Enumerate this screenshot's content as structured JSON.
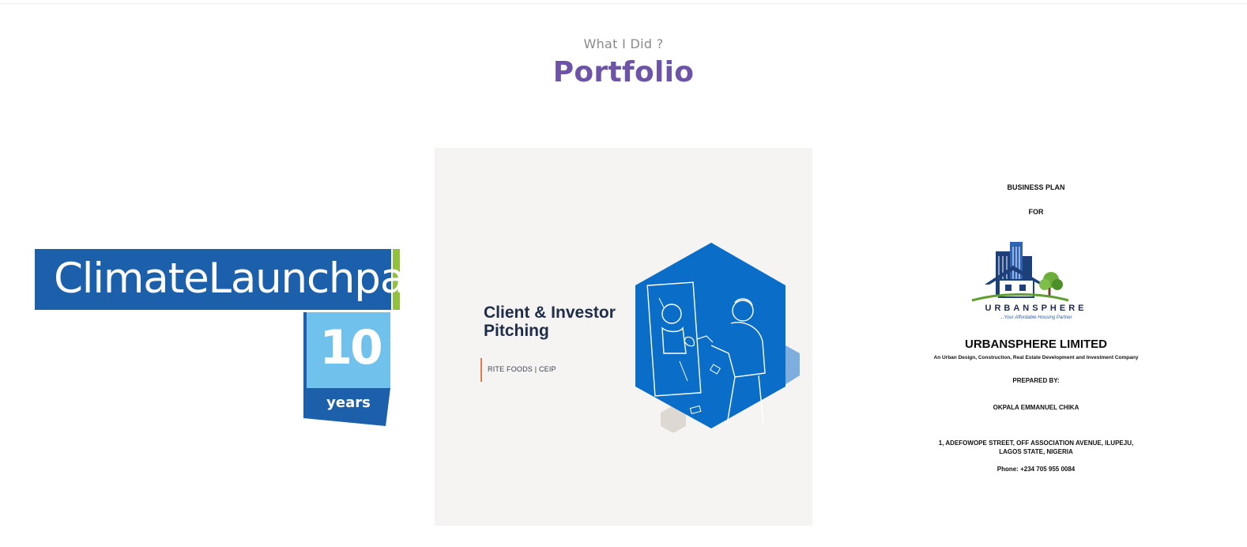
{
  "section": {
    "subtitle": "What I Did ?",
    "title": "Portfolio"
  },
  "colors": {
    "accent_purple": "#6d54a8",
    "climate_blue": "#1c60ab",
    "climate_green": "#94c13d",
    "climate_light_blue": "#70c2ec",
    "pitch_blue": "#0a6ec8",
    "pitch_accent": "#e07a52"
  },
  "portfolio": {
    "items": [
      {
        "logo_text": "ClimateLaunchpad",
        "badge_number": "10",
        "badge_label": "years"
      },
      {
        "title": "Client & Investor\nPitching",
        "subtitle": "RITE FOODS | CEIP",
        "illustration_icon": "handshake-pitch-icon"
      },
      {
        "heading": "BUSINESS PLAN",
        "for_label": "FOR",
        "logo_wordmark": "URBANSPHERE",
        "logo_tagline": "...Your Affordable Housing Partner",
        "company": "URBANSPHERE LIMITED",
        "description": "An Urban Design, Construction, Real Estate Development and Investment Company",
        "prepared_by_label": "PREPARED BY:",
        "author": "OKPALA EMMANUEL CHIKA",
        "address_line1": "1, ADEFOWOPE STREET, OFF ASSOCIATION AVENUE, ILUPEJU,",
        "address_line2": "LAGOS STATE, NIGERIA",
        "phone": "Phone: +234 705 955 0084"
      }
    ]
  }
}
